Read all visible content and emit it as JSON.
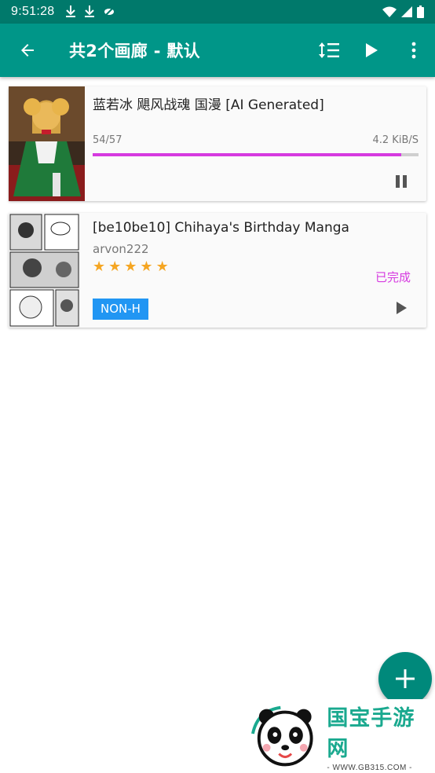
{
  "status_bar": {
    "time": "9:51:28",
    "icons": [
      "download-done-icon",
      "download-icon",
      "eye-off-icon"
    ],
    "right_icons": [
      "wifi-icon",
      "cell-signal-icon",
      "battery-icon"
    ]
  },
  "app_bar": {
    "title": "共2个画廊 - 默认",
    "icons": [
      "back-arrow-icon",
      "sort-icon",
      "play-icon",
      "more-vert-icon"
    ]
  },
  "colors": {
    "status_bar": "#00796b",
    "app_bar": "#009688",
    "progress": "#d63ae0",
    "badge": "#2196f3",
    "star": "#f5a623",
    "fab": "#00897b"
  },
  "downloads": [
    {
      "title": "蓝若冰 飓风战魂 国漫 [AI Generated]",
      "progress_text": "54/57",
      "progress_fraction": 0.947,
      "speed": "4.2 KiB/S",
      "action_icon": "pause-icon"
    },
    {
      "title": "[be10be10] Chihaya's Birthday Manga",
      "uploader": "arvon222",
      "rating": 5,
      "state": "已完成",
      "category": "NON-H",
      "action_icon": "play-icon"
    }
  ],
  "fab_icon": "add-icon",
  "watermark": {
    "name": "国宝手游网",
    "url": "- WWW.GB315.COM -"
  }
}
